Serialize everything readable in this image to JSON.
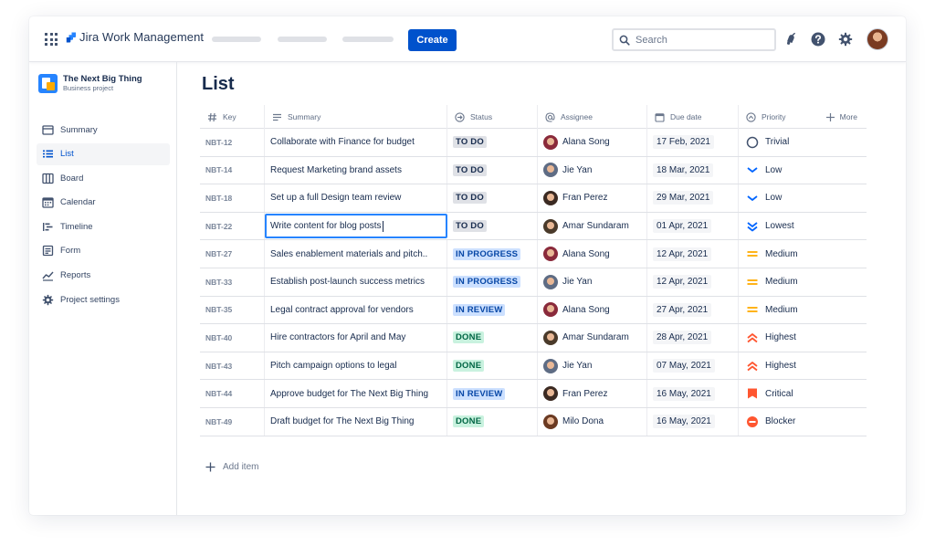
{
  "app": {
    "product_name": "Jira Work Management",
    "create_label": "Create",
    "search_placeholder": "Search"
  },
  "project": {
    "name": "The Next Big Thing",
    "type": "Business project"
  },
  "sidebar": {
    "items": [
      {
        "label": "Summary",
        "icon": "summary-icon"
      },
      {
        "label": "List",
        "icon": "list-icon",
        "active": true
      },
      {
        "label": "Board",
        "icon": "board-icon"
      },
      {
        "label": "Calendar",
        "icon": "calendar-icon"
      },
      {
        "label": "Timeline",
        "icon": "timeline-icon"
      },
      {
        "label": "Form",
        "icon": "form-icon"
      },
      {
        "label": "Reports",
        "icon": "reports-icon"
      },
      {
        "label": "Project settings",
        "icon": "settings-icon"
      }
    ]
  },
  "page": {
    "title": "List"
  },
  "table": {
    "headers": {
      "key": "Key",
      "summary": "Summary",
      "status": "Status",
      "assignee": "Assignee",
      "due": "Due date",
      "priority": "Priority",
      "more": "More"
    },
    "rows": [
      {
        "key": "NBT-12",
        "summary": "Collaborate with Finance for budget",
        "status": "TO DO",
        "assignee": "Alana Song",
        "due": "17 Feb, 2021",
        "priority": "Trivial"
      },
      {
        "key": "NBT-14",
        "summary": "Request Marketing brand assets",
        "status": "TO DO",
        "assignee": "Jie Yan",
        "due": "18 Mar, 2021",
        "priority": "Low"
      },
      {
        "key": "NBT-18",
        "summary": "Set up a full Design team review",
        "status": "TO DO",
        "assignee": "Fran Perez",
        "due": "29 Mar, 2021",
        "priority": "Low"
      },
      {
        "key": "NBT-22",
        "summary": "Write content for blog posts",
        "status": "TO DO",
        "assignee": "Amar Sundaram",
        "due": "01 Apr, 2021",
        "priority": "Lowest",
        "editing": true
      },
      {
        "key": "NBT-27",
        "summary": "Sales enablement materials and pitch..",
        "status": "IN PROGRESS",
        "assignee": "Alana Song",
        "due": "12 Apr, 2021",
        "priority": "Medium"
      },
      {
        "key": "NBT-33",
        "summary": "Establish post-launch success metrics",
        "status": "IN PROGRESS",
        "assignee": "Jie Yan",
        "due": "12 Apr, 2021",
        "priority": "Medium"
      },
      {
        "key": "NBT-35",
        "summary": "Legal contract approval for vendors",
        "status": "IN REVIEW",
        "assignee": "Alana Song",
        "due": "27 Apr, 2021",
        "priority": "Medium"
      },
      {
        "key": "NBT-40",
        "summary": "Hire contractors for April and May",
        "status": "DONE",
        "assignee": "Amar Sundaram",
        "due": "28 Apr, 2021",
        "priority": "Highest"
      },
      {
        "key": "NBT-43",
        "summary": "Pitch campaign options to legal",
        "status": "DONE",
        "assignee": "Jie Yan",
        "due": "07 May, 2021",
        "priority": "Highest"
      },
      {
        "key": "NBT-44",
        "summary": "Approve budget for The Next Big Thing",
        "status": "IN REVIEW",
        "assignee": "Fran Perez",
        "due": "16 May, 2021",
        "priority": "Critical"
      },
      {
        "key": "NBT-49",
        "summary": "Draft budget for The Next Big Thing",
        "status": "DONE",
        "assignee": "Milo Dona",
        "due": "16 May, 2021",
        "priority": "Blocker"
      }
    ],
    "add_item_label": "Add item"
  },
  "colors": {
    "brand_blue": "#0052cc",
    "todo_bg": "#dfe1e6",
    "progress_bg": "#cce0ff",
    "done_bg": "#c9f2df",
    "priority_low_blue": "#0065ff",
    "priority_medium_orange": "#ffab00",
    "priority_high_red": "#ff5630"
  }
}
